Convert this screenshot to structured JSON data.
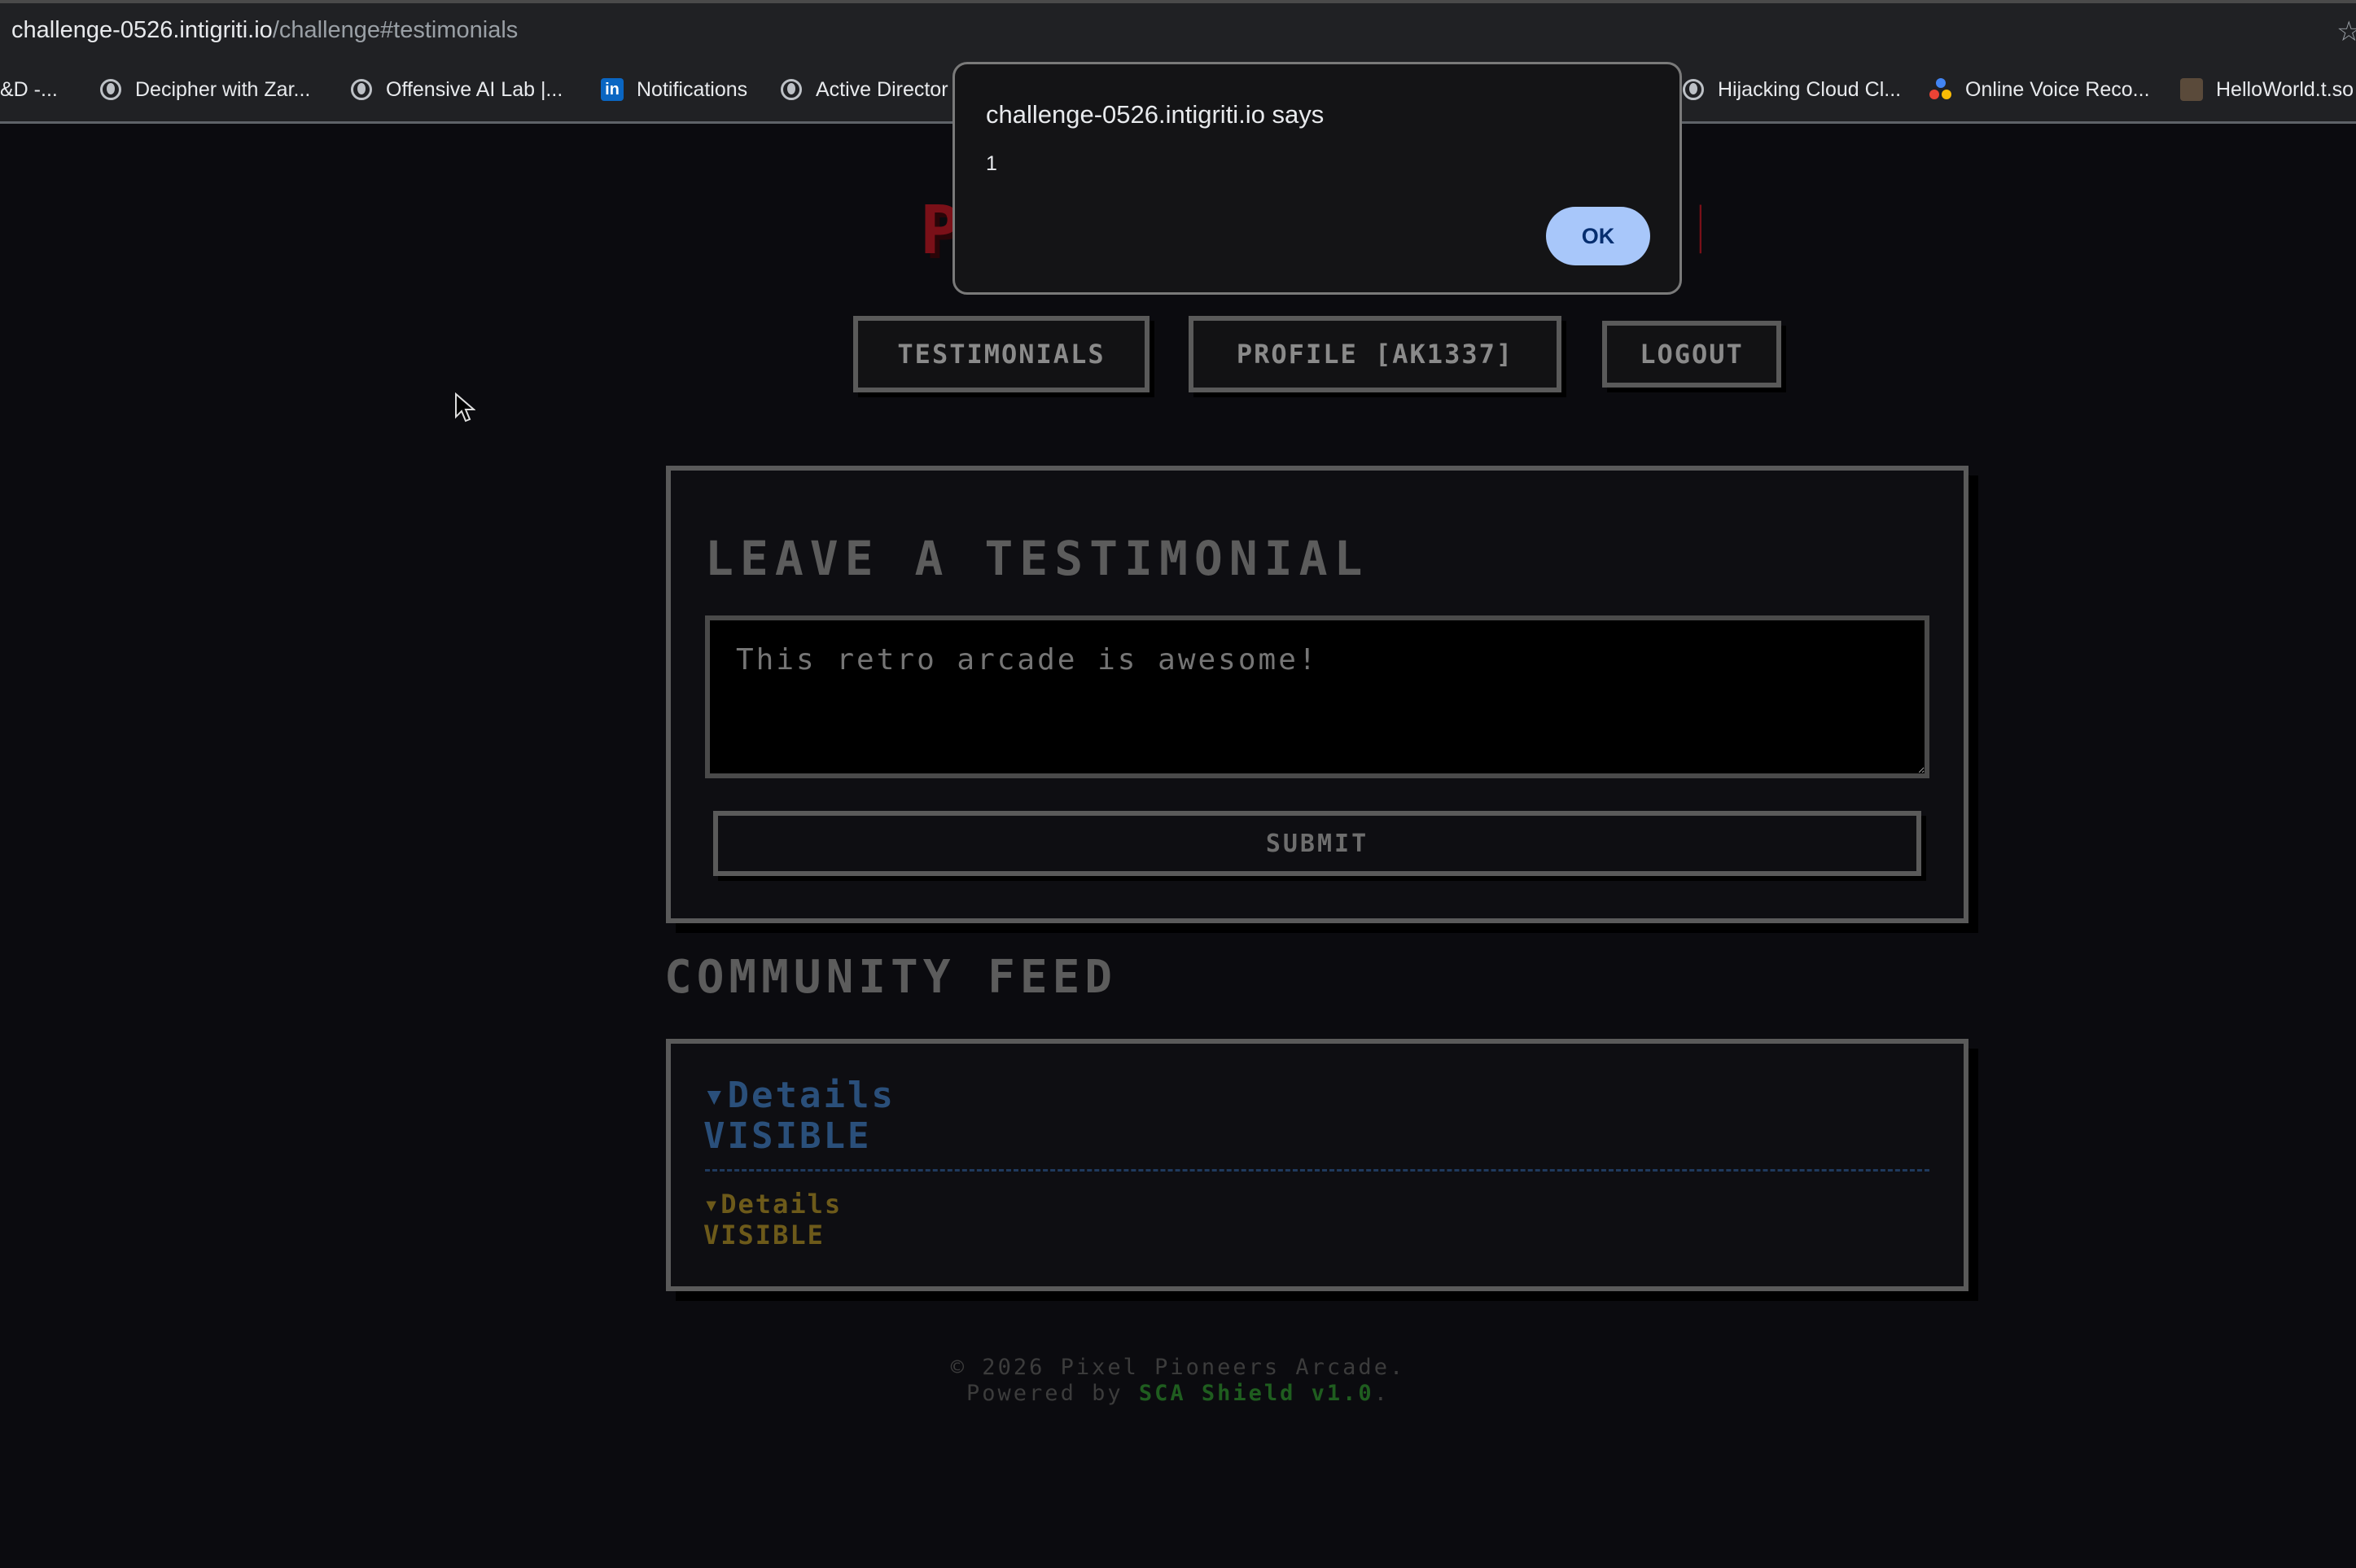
{
  "browser": {
    "url_host": "challenge-0526.intigriti.io",
    "url_path": "/challenge#testimonials",
    "bookmarks": [
      {
        "label": "&D -...",
        "icon": "none"
      },
      {
        "label": "Decipher with Zar...",
        "icon": "globe-icon"
      },
      {
        "label": "Offensive AI Lab |...",
        "icon": "globe-icon"
      },
      {
        "label": "Notifications",
        "icon": "linkedin-icon"
      },
      {
        "label": "Active Director",
        "icon": "globe-icon"
      },
      {
        "label": "Hijacking Cloud Cl...",
        "icon": "globe-icon"
      },
      {
        "label": "Online Voice Reco...",
        "icon": "google-dots-icon"
      },
      {
        "label": "HelloWorld.t.so",
        "icon": "favicon-image"
      }
    ]
  },
  "nav": {
    "testimonials": "TESTIMONIALS",
    "profile": "PROFILE [AK1337]",
    "logout": "LOGOUT"
  },
  "form": {
    "title": "LEAVE A TESTIMONIAL",
    "placeholder": "This retro arcade is awesome!",
    "submit": "SUBMIT"
  },
  "feed": {
    "title": "COMMUNITY FEED",
    "entries": [
      {
        "summary": "▾Details",
        "text": "VISIBLE",
        "color": "#2a4f7a"
      },
      {
        "summary": "▾Details",
        "text": "VISIBLE",
        "color": "#6d5a1a"
      }
    ]
  },
  "footer": {
    "line1": "© 2026 Pixel Pioneers Arcade.",
    "powered": "Powered by",
    "shield": "SCA Shield v1.0",
    "period": "."
  },
  "dialog": {
    "title": "challenge-0526.intigriti.io says",
    "message": "1",
    "ok": "OK"
  },
  "colors": {
    "background": "#0b0b0f",
    "dialog_button": "#a8c7fa",
    "accent_green": "#1f5d1f"
  }
}
